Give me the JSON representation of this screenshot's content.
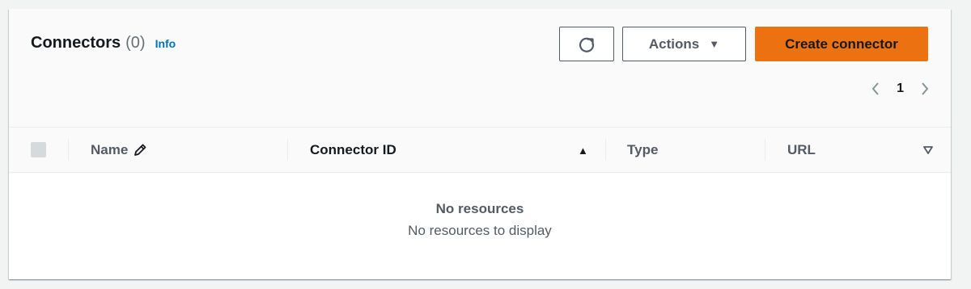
{
  "header": {
    "title": "Connectors",
    "count": "(0)",
    "info_link": "Info"
  },
  "toolbar": {
    "refresh_icon": "refresh-icon",
    "actions_label": "Actions",
    "create_label": "Create connector"
  },
  "pagination": {
    "prev_icon": "chevron-left-icon",
    "current_page": "1",
    "next_icon": "chevron-right-icon"
  },
  "table": {
    "columns": [
      {
        "label": "Name",
        "icon": "edit-pencil-icon"
      },
      {
        "label": "Connector ID",
        "sort": "ascending"
      },
      {
        "label": "Type"
      },
      {
        "label": "URL"
      }
    ],
    "empty_title": "No resources",
    "empty_message": "No resources to display"
  },
  "colors": {
    "accent": "#ec7211",
    "link": "#0073bb",
    "text": "#16191f",
    "muted": "#545b64"
  }
}
